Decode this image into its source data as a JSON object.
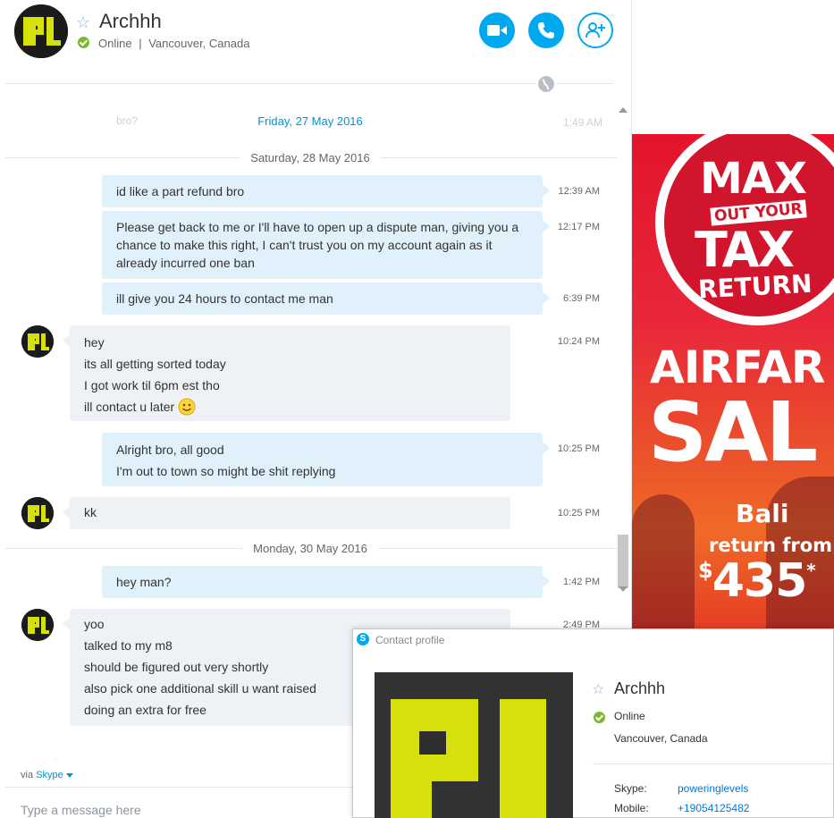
{
  "header": {
    "name": "Archhh",
    "status": "Online",
    "separator": "|",
    "location": "Vancouver, Canada",
    "accent_color": "#00a9ef",
    "online_color": "#7cb82f",
    "buttons": [
      {
        "icon": "video-call-icon"
      },
      {
        "icon": "phone-call-icon"
      },
      {
        "icon": "add-contact-icon"
      }
    ]
  },
  "conversation": {
    "faded_top": {
      "text": "bro?",
      "time": "1:49 AM"
    },
    "dates": [
      "Friday, 27 May 2016",
      "Saturday, 28 May 2016",
      "Monday, 30 May 2016"
    ],
    "messages": [
      {
        "dir": "out",
        "lines": [
          "id like a part refund bro"
        ],
        "time": "12:39 AM"
      },
      {
        "dir": "out",
        "lines": [
          "Please get back to me or I'll have to open up a dispute man, giving you a",
          "chance to make this right, I can't trust you on my account again as it",
          "already incurred one ban"
        ],
        "time": "12:17 PM"
      },
      {
        "dir": "out",
        "lines": [
          "ill give you 24 hours to contact me man"
        ],
        "time": "6:39 PM"
      },
      {
        "dir": "in",
        "lines": [
          "hey",
          "its all getting sorted today",
          "I got work til 6pm est tho",
          "ill contact u later"
        ],
        "time": "10:24 PM"
      },
      {
        "dir": "out",
        "lines": [
          "Alright bro, all good",
          "I'm out to town so might be shit replying"
        ],
        "time": "10:25 PM"
      },
      {
        "dir": "in",
        "lines": [
          "kk"
        ],
        "time": "10:25 PM"
      },
      {
        "dir": "out",
        "lines": [
          "hey man?"
        ],
        "time": "1:42 PM"
      },
      {
        "dir": "in",
        "lines": [
          "yoo",
          "talked to my m8",
          "should be figured out very shortly",
          "also pick one additional skill u want raised",
          "doing an extra for free"
        ],
        "time": "2:49 PM"
      }
    ]
  },
  "composer": {
    "via_label": "via",
    "via_link": "Skype",
    "placeholder": "Type a message here"
  },
  "ad": {
    "max": "MAX",
    "out_your": "OUT YOUR",
    "tax": "TAX",
    "return": "RETURN",
    "airfare": "AIRFAR",
    "sale": "SAL",
    "destination": "Bali",
    "return_from": "return from",
    "currency": "$",
    "price": "435",
    "asterisk": "*"
  },
  "profile_popup": {
    "title": "Contact profile",
    "name": "Archhh",
    "status": "Online",
    "location": "Vancouver, Canada",
    "skype_label": "Skype:",
    "skype_value": "poweringlevels",
    "mobile_label": "Mobile:",
    "mobile_value": "+19054125482"
  }
}
